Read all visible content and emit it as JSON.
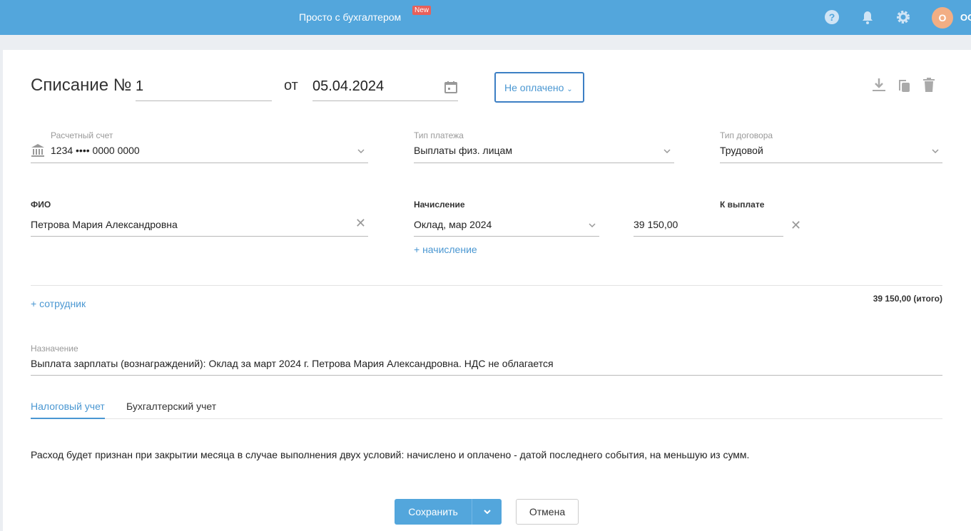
{
  "header": {
    "brand": "Просто с бухгалтером",
    "badge": "New",
    "avatar_letter": "О",
    "username": "ОО"
  },
  "doc": {
    "title": "Списание №",
    "number": "1",
    "from_label": "от",
    "date": "05.04.2024",
    "status": "Не оплачено"
  },
  "fields": {
    "account": {
      "label": "Расчетный счет",
      "value": "1234 •••• 0000 0000"
    },
    "payment_type": {
      "label": "Тип платежа",
      "value": "Выплаты физ. лицам"
    },
    "contract_type": {
      "label": "Тип договора",
      "value": "Трудовой"
    },
    "fio": {
      "label": "ФИО",
      "value": "Петрова Мария Александровна"
    },
    "accrual": {
      "label": "Начисление",
      "value": "Оклад, мар 2024"
    },
    "payout": {
      "label": "К выплате",
      "value": "39 150,00"
    },
    "add_accrual": "+ начисление",
    "add_employee": "+ сотрудник",
    "total": "39 150,00 (итого)",
    "purpose": {
      "label": "Назначение",
      "value": "Выплата зарплаты (вознаграждений): Оклад за март 2024 г. Петрова Мария Александровна. НДС не облагается"
    }
  },
  "tabs": [
    {
      "label": "Налоговый учет",
      "active": true
    },
    {
      "label": "Бухгалтерский учет",
      "active": false
    }
  ],
  "tax_note": "Расход будет признан при закрытии месяца в случае выполнения двух условий: начислено и оплачено - датой последнего события, на меньшую из сумм.",
  "buttons": {
    "save": "Сохранить",
    "cancel": "Отмена"
  }
}
